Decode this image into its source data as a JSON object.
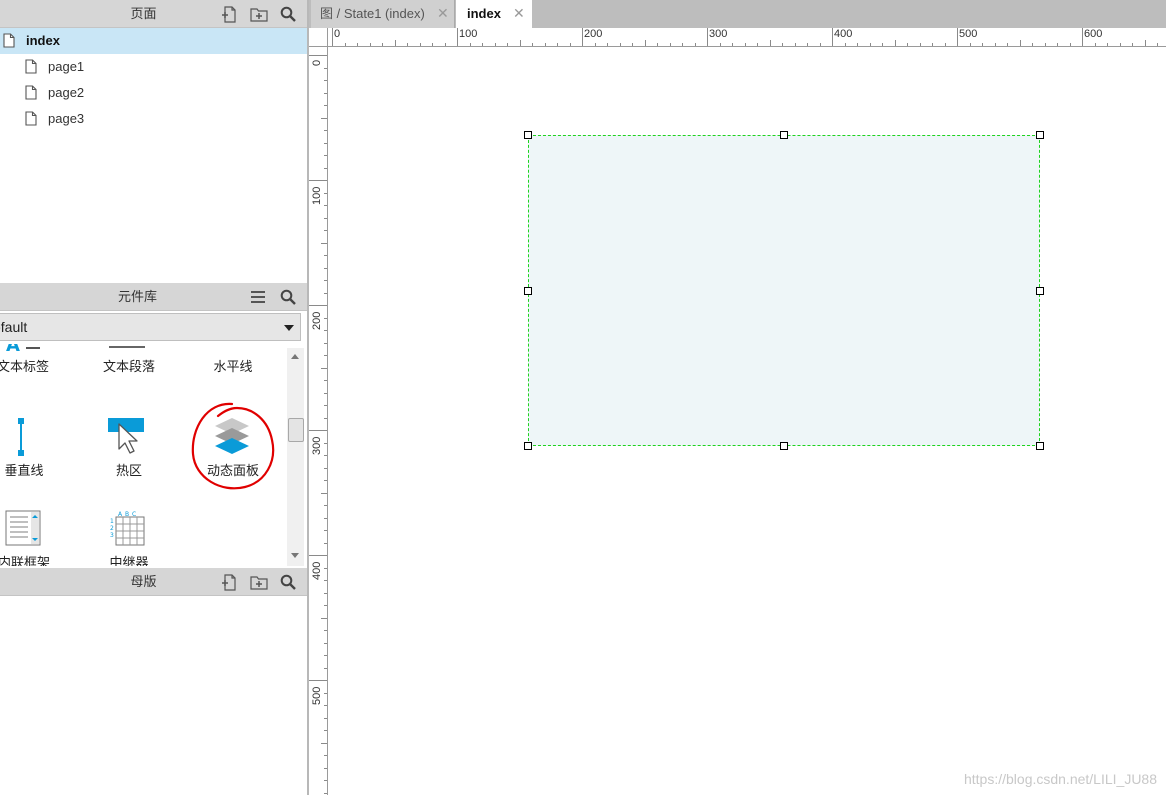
{
  "pages_panel": {
    "title": "页面",
    "pages": [
      {
        "label": "index",
        "selected": true
      },
      {
        "label": "page1",
        "selected": false
      },
      {
        "label": "page2",
        "selected": false
      },
      {
        "label": "page3",
        "selected": false
      }
    ]
  },
  "widgets_panel": {
    "title": "元件库",
    "library": "efault",
    "widgets": [
      {
        "label": "文本标签",
        "icon": "text-label-icon"
      },
      {
        "label": "文本段落",
        "icon": "text-paragraph-icon"
      },
      {
        "label": "水平线",
        "icon": "horizontal-line-icon"
      },
      {
        "label": "垂直线",
        "icon": "vertical-line-icon"
      },
      {
        "label": "热区",
        "icon": "hotspot-icon"
      },
      {
        "label": "动态面板",
        "icon": "dynamic-panel-icon"
      },
      {
        "label": "内联框架",
        "icon": "inline-frame-icon"
      },
      {
        "label": "中继器",
        "icon": "repeater-icon"
      }
    ]
  },
  "masters_panel": {
    "title": "母版"
  },
  "tabs": [
    {
      "label": "图 / State1 (index)",
      "active": false
    },
    {
      "label": "index",
      "active": true
    }
  ],
  "close_glyph": "✕",
  "ruler": {
    "horizontal": [
      "0",
      "100",
      "200",
      "300",
      "400",
      "500",
      "600"
    ],
    "vertical": [
      "0",
      "100",
      "200",
      "300",
      "400",
      "500"
    ]
  },
  "colors": {
    "selection_border": "#1fd31f",
    "panel_fill": "#eef6f8",
    "selected_page_bg": "#c9e6f6",
    "accent_blue": "#0a9bd8",
    "annotation_red": "#e00000"
  },
  "watermark": "https://blog.csdn.net/LILI_JU88"
}
